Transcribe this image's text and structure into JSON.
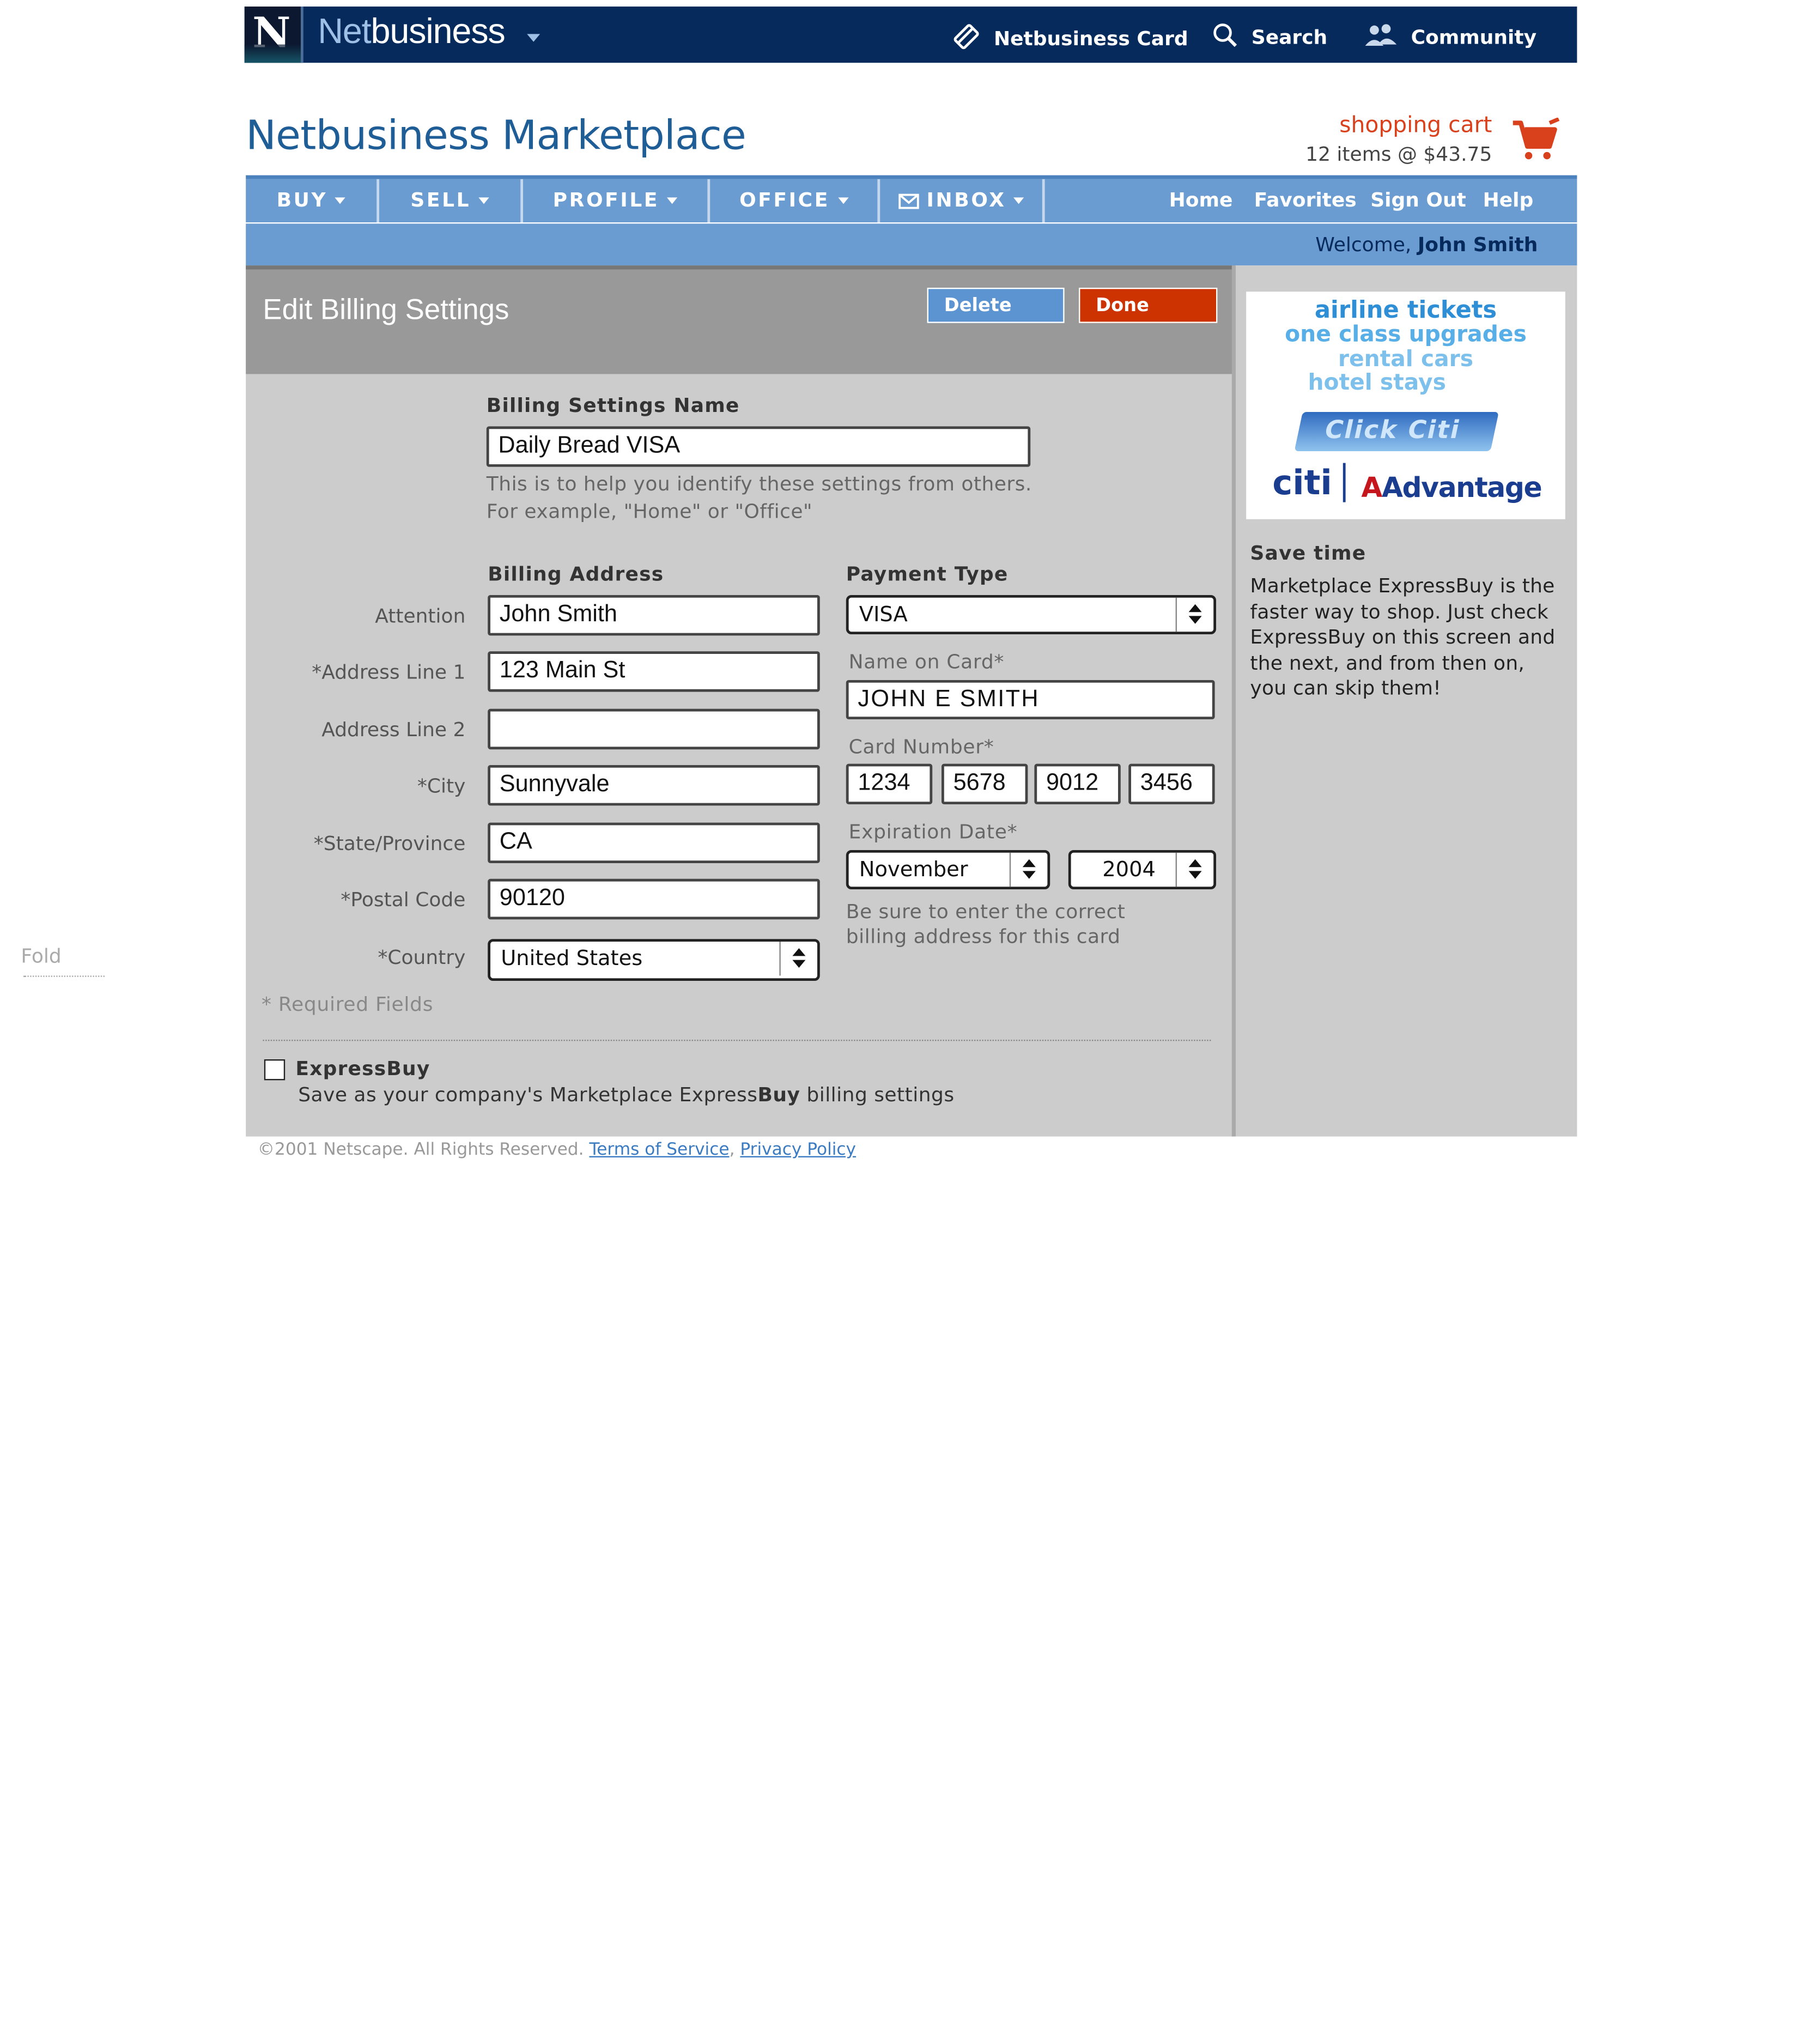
{
  "topbar": {
    "logo_letter": "N",
    "brand_prefix": "Net",
    "brand_suffix": "business",
    "links": [
      {
        "label": "Netbusiness Card",
        "icon": "card-icon"
      },
      {
        "label": "Search",
        "icon": "search-icon"
      },
      {
        "label": "Community",
        "icon": "community-icon"
      }
    ]
  },
  "header": {
    "title": "Netbusiness Marketplace",
    "cart_label": "shopping cart",
    "cart_summary": "12 items @ $43.75"
  },
  "nav": {
    "items": [
      "BUY",
      "SELL",
      "PROFILE",
      "OFFICE",
      "INBOX"
    ],
    "right_links": [
      "Home",
      "Favorites",
      "Sign Out",
      "Help"
    ],
    "welcome_prefix": "Welcome,",
    "user_name": "John Smith"
  },
  "panel": {
    "title": "Edit Billing Settings",
    "delete_label": "Delete",
    "done_label": "Done"
  },
  "form": {
    "settings_name_label": "Billing Settings Name",
    "settings_name_value": "Daily Bread VISA",
    "settings_hint_1": "This is to help you identify these settings from others.",
    "settings_hint_2": "For example, \"Home\" or \"Office\"",
    "billing_address_label": "Billing Address",
    "payment_type_label": "Payment Type",
    "fields": [
      {
        "label": "Attention",
        "value": "John Smith"
      },
      {
        "label": "*Address Line 1",
        "value": "123 Main St"
      },
      {
        "label": "Address Line 2",
        "value": ""
      },
      {
        "label": "*City",
        "value": "Sunnyvale"
      },
      {
        "label": "*State/Province",
        "value": "CA"
      },
      {
        "label": "*Postal Code",
        "value": "90120"
      },
      {
        "label": "*Country",
        "value": "United States"
      }
    ],
    "payment_type_value": "VISA",
    "name_on_card_label": "Name on Card*",
    "name_on_card_value": "JOHN E SMITH",
    "card_number_label": "Card Number*",
    "card_number_parts": [
      "1234",
      "5678",
      "9012",
      "3456"
    ],
    "expiration_label": "Expiration Date*",
    "exp_month": "November",
    "exp_year": "2004",
    "card_hint_1": "Be sure to enter the correct",
    "card_hint_2": "billing address for this card",
    "required_note": "* Required Fields",
    "expressbuy_label": "ExpressBuy",
    "expressbuy_text_1": "Save as your company's Marketplace Express",
    "expressbuy_text_bold": "Buy",
    "expressbuy_text_2": " billing settings"
  },
  "ad": {
    "lines": [
      "airline tickets",
      "one class upgrades",
      "rental cars",
      "hotel stays"
    ],
    "card_text": "Click Citi",
    "brand_left": "citi",
    "brand_right_a": "A",
    "brand_right": "Advantage"
  },
  "sidebar": {
    "title": "Save time",
    "text": "Marketplace ExpressBuy is the faster way to shop. Just check ExpressBuy on this screen and the next, and from then on, you can skip them!"
  },
  "fold_label": "Fold",
  "footer": {
    "copyright": "©2001 Netscape. All Rights Reserved.",
    "terms": "Terms of Service",
    "privacy": "Privacy Policy"
  }
}
